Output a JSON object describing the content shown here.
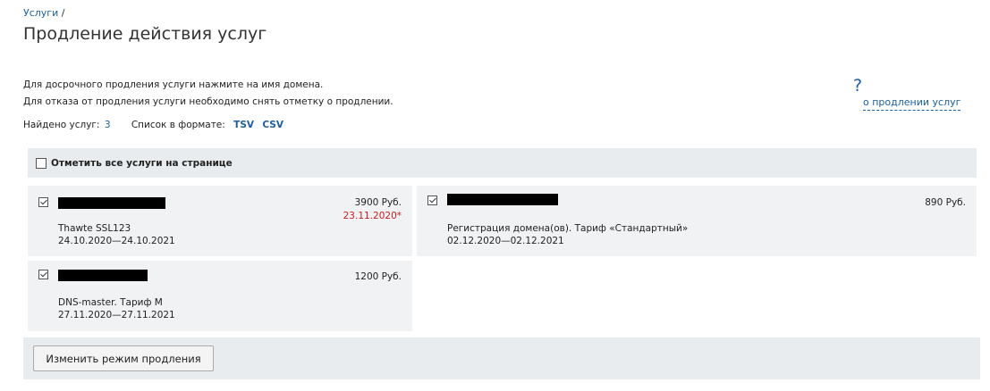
{
  "breadcrumb": {
    "link": "Услуги",
    "separator": "/"
  },
  "page_title": "Продление действия услуг",
  "description": {
    "line1": "Для досрочного продления услуги нажмите на имя домена.",
    "line2": "Для отказа от продления услуги необходимо снять отметку о продлении."
  },
  "summary": {
    "found_label": "Найдено услуг:",
    "found_count": "3",
    "format_label": "Список в формате:",
    "tsv": "TSV",
    "csv": "CSV"
  },
  "help": {
    "icon": "?",
    "link": "о продлении услуг"
  },
  "select_all": {
    "label": "Отметить все услуги на странице",
    "checked": false
  },
  "services": [
    {
      "checked": true,
      "domain_redacted": true,
      "price": "3900 Руб.",
      "warn_date": "23.11.2020*",
      "name": "Thawte SSL123",
      "period": "24.10.2020—24.10.2021"
    },
    {
      "checked": true,
      "domain_redacted": true,
      "price": "890 Руб.",
      "warn_date": "",
      "name": "Регистрация домена(ов). Тариф «Стандартный»",
      "period": "02.12.2020—02.12.2021"
    },
    {
      "checked": true,
      "domain_redacted": true,
      "price": "1200 Руб.",
      "warn_date": "",
      "name": "DNS-master. Тариф М",
      "period": "27.11.2020—27.11.2021"
    }
  ],
  "actions": {
    "change_mode": "Изменить режим продления"
  },
  "colors": {
    "link": "#1a5fa3",
    "warning": "#d01a1a",
    "panel": "#f1f2f3",
    "bar": "#e9ecee"
  }
}
